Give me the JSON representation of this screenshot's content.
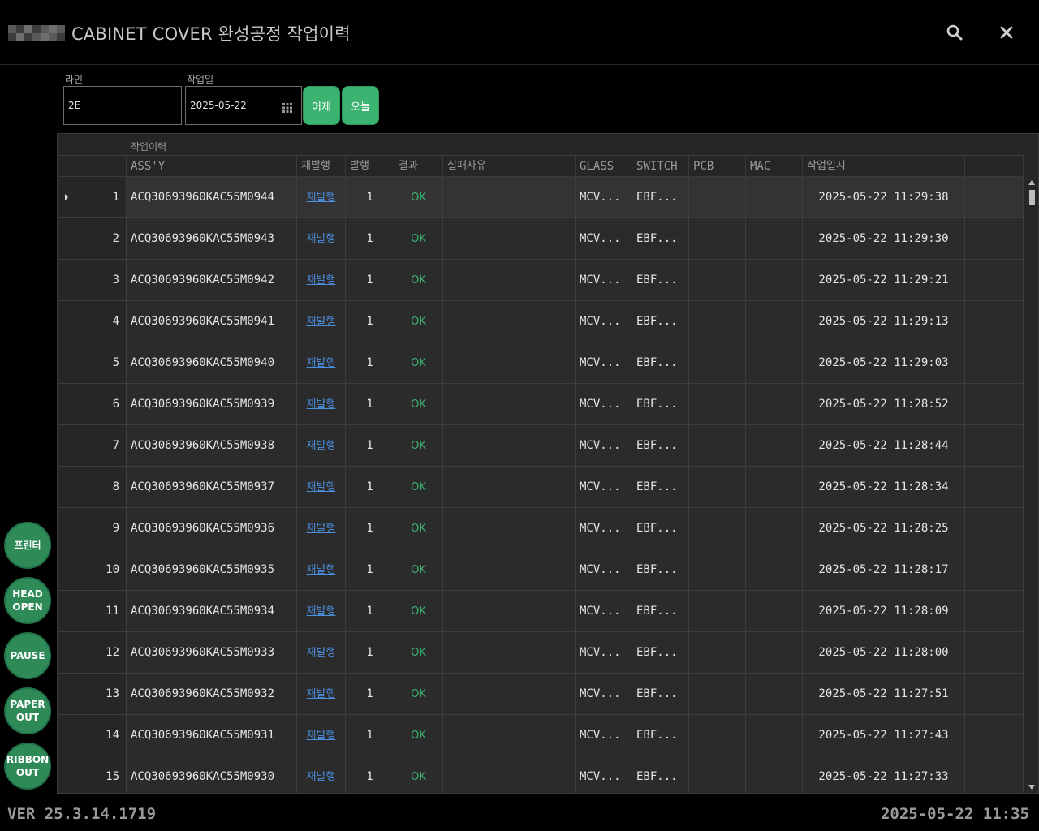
{
  "window": {
    "title": "CABINET COVER 완성공정 작업이력"
  },
  "filter": {
    "line_label": "라인",
    "line_value": "2E",
    "date_label": "작업일",
    "date_value": "2025-05-22",
    "yesterday_label": "어제",
    "today_label": "오늘"
  },
  "grid": {
    "group_header": "작업이력",
    "columns": [
      "ASS'Y",
      "재발행",
      "발행",
      "결과",
      "실패사유",
      "GLASS",
      "SWITCH",
      "PCB",
      "MAC",
      "작업일시"
    ],
    "selected_row": 1,
    "rows": [
      {
        "no": "1",
        "assy": "ACQ30693960KAC55M0944",
        "reissue": "재발행",
        "count": "1",
        "result": "OK",
        "reason": "",
        "glass": "MCV...",
        "switch": "EBF...",
        "pcb": "",
        "mac": "",
        "datetime": "2025-05-22 11:29:38"
      },
      {
        "no": "2",
        "assy": "ACQ30693960KAC55M0943",
        "reissue": "재발행",
        "count": "1",
        "result": "OK",
        "reason": "",
        "glass": "MCV...",
        "switch": "EBF...",
        "pcb": "",
        "mac": "",
        "datetime": "2025-05-22 11:29:30"
      },
      {
        "no": "3",
        "assy": "ACQ30693960KAC55M0942",
        "reissue": "재발행",
        "count": "1",
        "result": "OK",
        "reason": "",
        "glass": "MCV...",
        "switch": "EBF...",
        "pcb": "",
        "mac": "",
        "datetime": "2025-05-22 11:29:21"
      },
      {
        "no": "4",
        "assy": "ACQ30693960KAC55M0941",
        "reissue": "재발행",
        "count": "1",
        "result": "OK",
        "reason": "",
        "glass": "MCV...",
        "switch": "EBF...",
        "pcb": "",
        "mac": "",
        "datetime": "2025-05-22 11:29:13"
      },
      {
        "no": "5",
        "assy": "ACQ30693960KAC55M0940",
        "reissue": "재발행",
        "count": "1",
        "result": "OK",
        "reason": "",
        "glass": "MCV...",
        "switch": "EBF...",
        "pcb": "",
        "mac": "",
        "datetime": "2025-05-22 11:29:03"
      },
      {
        "no": "6",
        "assy": "ACQ30693960KAC55M0939",
        "reissue": "재발행",
        "count": "1",
        "result": "OK",
        "reason": "",
        "glass": "MCV...",
        "switch": "EBF...",
        "pcb": "",
        "mac": "",
        "datetime": "2025-05-22 11:28:52"
      },
      {
        "no": "7",
        "assy": "ACQ30693960KAC55M0938",
        "reissue": "재발행",
        "count": "1",
        "result": "OK",
        "reason": "",
        "glass": "MCV...",
        "switch": "EBF...",
        "pcb": "",
        "mac": "",
        "datetime": "2025-05-22 11:28:44"
      },
      {
        "no": "8",
        "assy": "ACQ30693960KAC55M0937",
        "reissue": "재발행",
        "count": "1",
        "result": "OK",
        "reason": "",
        "glass": "MCV...",
        "switch": "EBF...",
        "pcb": "",
        "mac": "",
        "datetime": "2025-05-22 11:28:34"
      },
      {
        "no": "9",
        "assy": "ACQ30693960KAC55M0936",
        "reissue": "재발행",
        "count": "1",
        "result": "OK",
        "reason": "",
        "glass": "MCV...",
        "switch": "EBF...",
        "pcb": "",
        "mac": "",
        "datetime": "2025-05-22 11:28:25"
      },
      {
        "no": "10",
        "assy": "ACQ30693960KAC55M0935",
        "reissue": "재발행",
        "count": "1",
        "result": "OK",
        "reason": "",
        "glass": "MCV...",
        "switch": "EBF...",
        "pcb": "",
        "mac": "",
        "datetime": "2025-05-22 11:28:17"
      },
      {
        "no": "11",
        "assy": "ACQ30693960KAC55M0934",
        "reissue": "재발행",
        "count": "1",
        "result": "OK",
        "reason": "",
        "glass": "MCV...",
        "switch": "EBF...",
        "pcb": "",
        "mac": "",
        "datetime": "2025-05-22 11:28:09"
      },
      {
        "no": "12",
        "assy": "ACQ30693960KAC55M0933",
        "reissue": "재발행",
        "count": "1",
        "result": "OK",
        "reason": "",
        "glass": "MCV...",
        "switch": "EBF...",
        "pcb": "",
        "mac": "",
        "datetime": "2025-05-22 11:28:00"
      },
      {
        "no": "13",
        "assy": "ACQ30693960KAC55M0932",
        "reissue": "재발행",
        "count": "1",
        "result": "OK",
        "reason": "",
        "glass": "MCV...",
        "switch": "EBF...",
        "pcb": "",
        "mac": "",
        "datetime": "2025-05-22 11:27:51"
      },
      {
        "no": "14",
        "assy": "ACQ30693960KAC55M0931",
        "reissue": "재발행",
        "count": "1",
        "result": "OK",
        "reason": "",
        "glass": "MCV...",
        "switch": "EBF...",
        "pcb": "",
        "mac": "",
        "datetime": "2025-05-22 11:27:43"
      },
      {
        "no": "15",
        "assy": "ACQ30693960KAC55M0930",
        "reissue": "재발행",
        "count": "1",
        "result": "OK",
        "reason": "",
        "glass": "MCV...",
        "switch": "EBF...",
        "pcb": "",
        "mac": "",
        "datetime": "2025-05-22 11:27:33"
      }
    ]
  },
  "side_buttons": [
    {
      "name": "printer-button",
      "label": "프린터"
    },
    {
      "name": "head-open-button",
      "label": "HEAD\nOPEN"
    },
    {
      "name": "pause-button",
      "label": "PAUSE"
    },
    {
      "name": "paper-out-button",
      "label": "PAPER\nOUT"
    },
    {
      "name": "ribbon-out-button",
      "label": "RIBBON\nOUT"
    }
  ],
  "status": {
    "version": "VER 25.3.14.1719",
    "clock": "2025-05-22 11:35"
  },
  "icons": {
    "search": "search-icon",
    "close": "close-icon",
    "calendar": "calendar-icon"
  },
  "colors": {
    "accent_green": "#3cb371",
    "ok_text": "#3cb371",
    "link_blue": "#4a8fe0",
    "background": "#000000",
    "grid_background": "#2b2b2b"
  }
}
